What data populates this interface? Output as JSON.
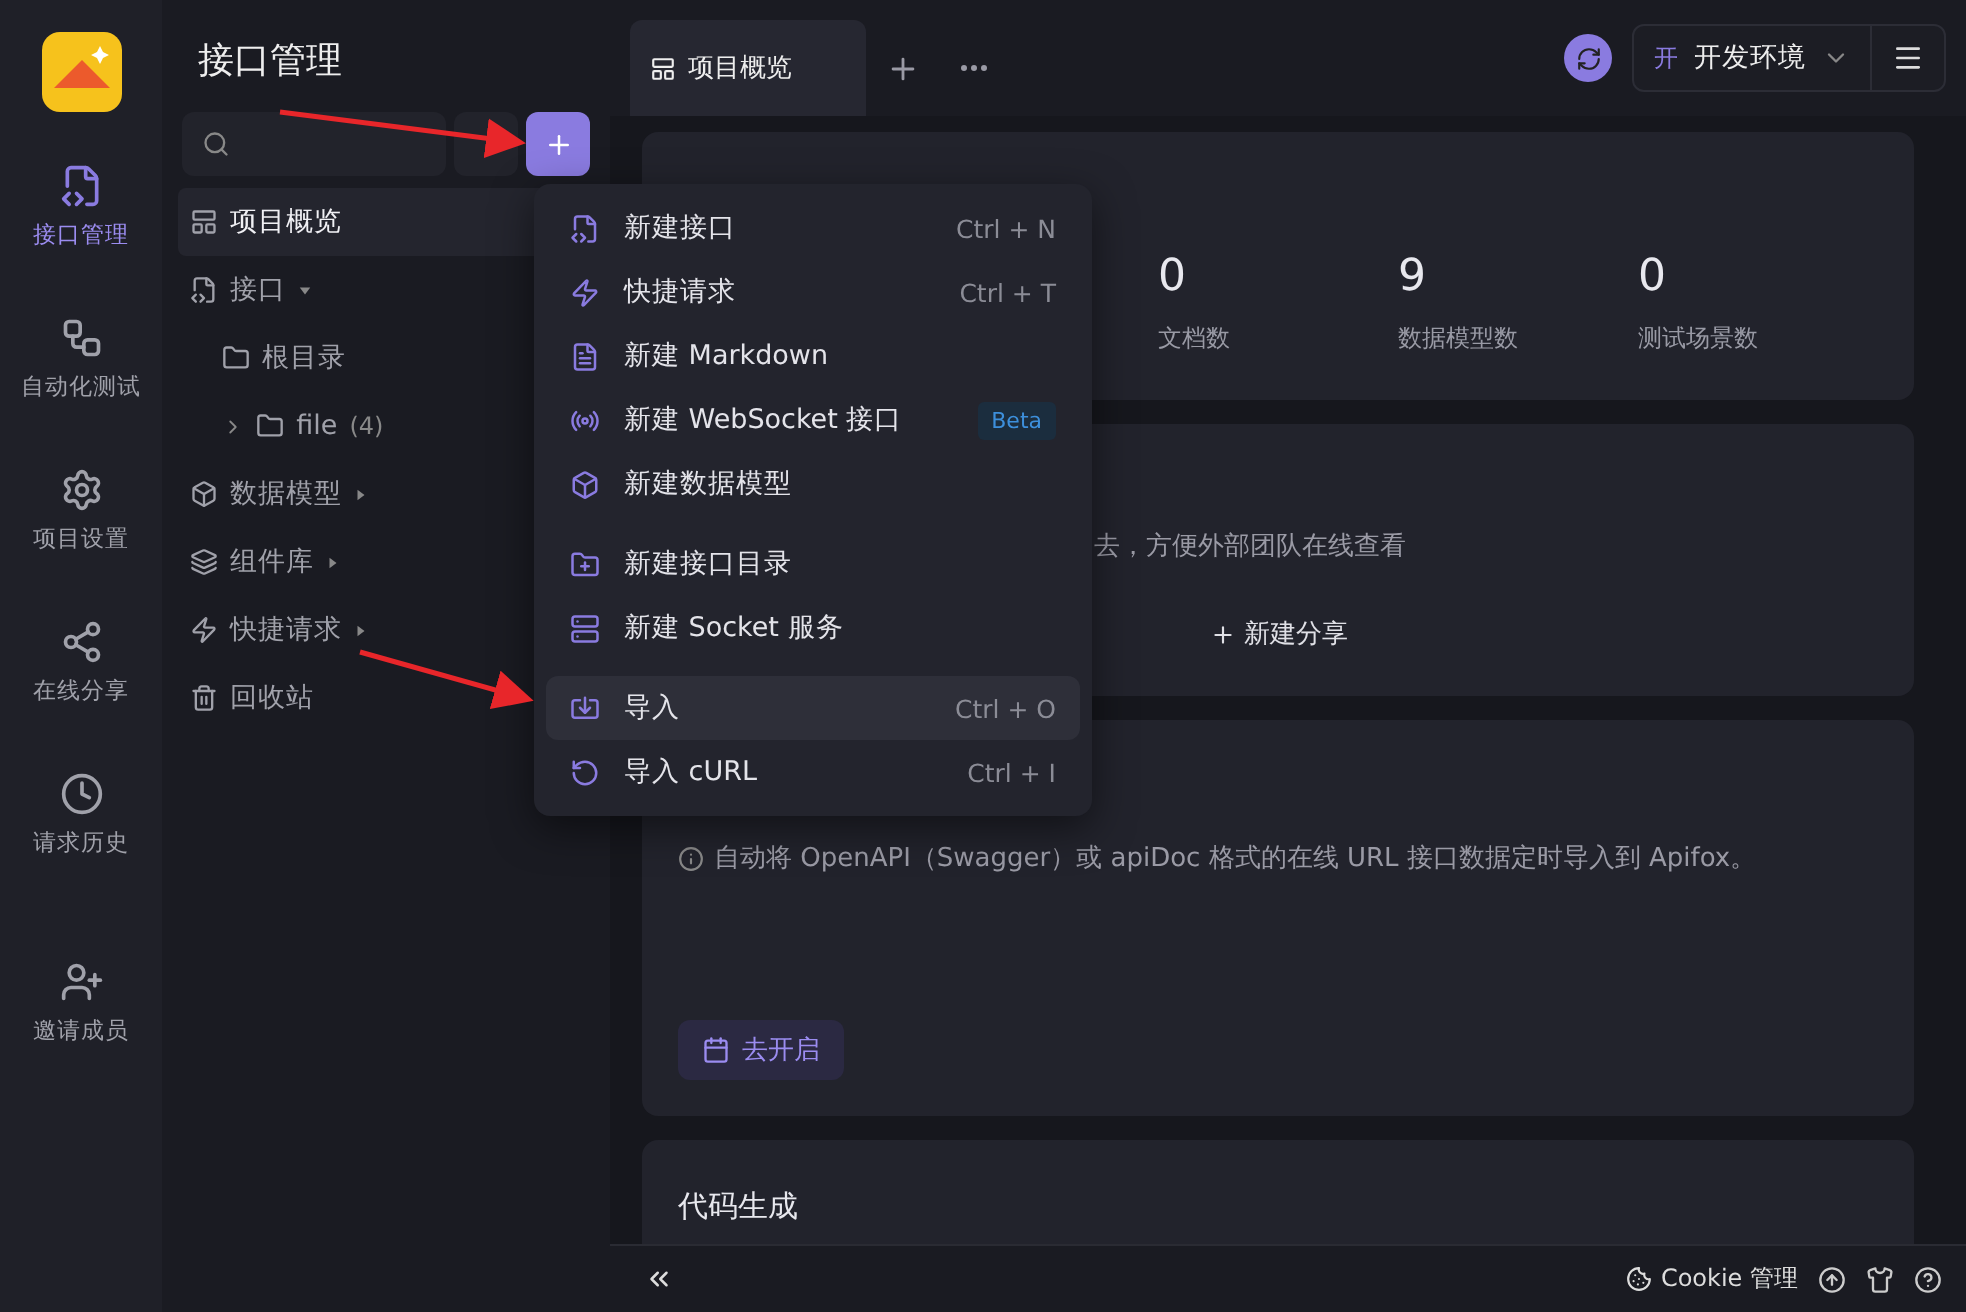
{
  "rail": {
    "items": [
      {
        "label": "接口管理",
        "selected": true
      },
      {
        "label": "自动化测试",
        "selected": false
      },
      {
        "label": "项目设置",
        "selected": false
      },
      {
        "label": "在线分享",
        "selected": false
      },
      {
        "label": "请求历史",
        "selected": false
      }
    ],
    "bottom": [
      {
        "label": "邀请成员",
        "selected": false
      }
    ]
  },
  "sidebar": {
    "title": "接口管理",
    "tree": [
      {
        "label": "项目概览",
        "selected": true
      },
      {
        "label": "接口",
        "selected": false,
        "expanded": true,
        "children": [
          {
            "label": "根目录",
            "selected": false
          },
          {
            "label": "file",
            "count": "(4)",
            "selected": false,
            "expanded": false
          }
        ]
      },
      {
        "label": "数据模型",
        "selected": false,
        "expanded": false
      },
      {
        "label": "组件库",
        "selected": false,
        "expanded": false
      },
      {
        "label": "快捷请求",
        "selected": false,
        "expanded": false
      },
      {
        "label": "回收站",
        "selected": false
      }
    ]
  },
  "tabs": [
    {
      "label": "项目概览",
      "selected": true
    }
  ],
  "env": {
    "badge": "开",
    "label": "开发环境"
  },
  "stats": [
    {
      "value": "0",
      "label": "文档数"
    },
    {
      "value": "9",
      "label": "数据模型数"
    },
    {
      "value": "0",
      "label": "测试场景数"
    }
  ],
  "share_card": {
    "text": "去，方便外部团队在线查看",
    "button": "新建分享"
  },
  "import_card": {
    "text": "自动将 OpenAPI（Swagger）或 apiDoc 格式的在线 URL 接口数据定时导入到 Apifox。",
    "button": "去开启"
  },
  "code_card": {
    "title": "代码生成"
  },
  "footer": {
    "cookie": "Cookie 管理"
  },
  "menu": {
    "groups": [
      [
        {
          "label": "新建接口",
          "shortcut": "Ctrl + N",
          "selected": false
        },
        {
          "label": "快捷请求",
          "shortcut": "Ctrl + T",
          "selected": false
        },
        {
          "label": "新建 Markdown",
          "selected": false
        },
        {
          "label": "新建 WebSocket 接口",
          "badge": "Beta",
          "selected": false
        },
        {
          "label": "新建数据模型",
          "selected": false
        }
      ],
      [
        {
          "label": "新建接口目录",
          "selected": false
        },
        {
          "label": "新建 Socket 服务",
          "selected": false
        }
      ],
      [
        {
          "label": "导入",
          "shortcut": "Ctrl + O",
          "selected": true
        },
        {
          "label": "导入 cURL",
          "shortcut": "Ctrl + I",
          "selected": false
        }
      ]
    ]
  }
}
